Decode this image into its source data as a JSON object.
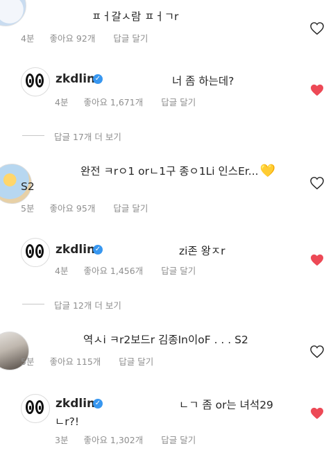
{
  "comments": [
    {
      "text": "ㅍㅓ갈ㅅ람 ㅍㅓㄱr",
      "time": "4분",
      "likes": "좋아요 92개",
      "reply": "답글 달기"
    },
    {
      "username": "zkdlin",
      "text": "너 좀 하는데?",
      "time": "4분",
      "likes": "좋아요 1,671개",
      "reply": "답글 달기"
    },
    {
      "text_line1": "완전 ㅋrㅇ1 orㄴ1구 종ㅇ1Li 인스Er...",
      "text_line2": "S2",
      "time": "5분",
      "likes": "좋아요 95개",
      "reply": "답글 달기"
    },
    {
      "username": "zkdlin",
      "text": "zi존 왕ㅈr",
      "time": "4분",
      "likes": "좋아요 1,456개",
      "reply": "답글 달기"
    },
    {
      "text": "역ㅅi ㅋr2보드r 김종In이oF . . . S2",
      "time": "5분",
      "likes": "좋아요 115개",
      "reply": "답글 달기"
    },
    {
      "username": "zkdlin",
      "text_line1": "ㄴㄱ 좀 or는 녀석29",
      "text_line2": "ㄴr?!",
      "time": "3분",
      "likes": "좋아요 1,302개",
      "reply": "답글 달기"
    }
  ],
  "view_replies": [
    {
      "label": "답글 17개 더 보기"
    },
    {
      "label": "답글 12개 더 보기"
    }
  ],
  "icons": {
    "like": "heart-icon",
    "liked": "heart-filled-icon",
    "verified": "verified-badge-icon",
    "emoji": "yellow-heart-emoji"
  },
  "colors": {
    "liked": "#ed4956",
    "verified": "#3897f0",
    "meta": "#8e8e8e"
  }
}
